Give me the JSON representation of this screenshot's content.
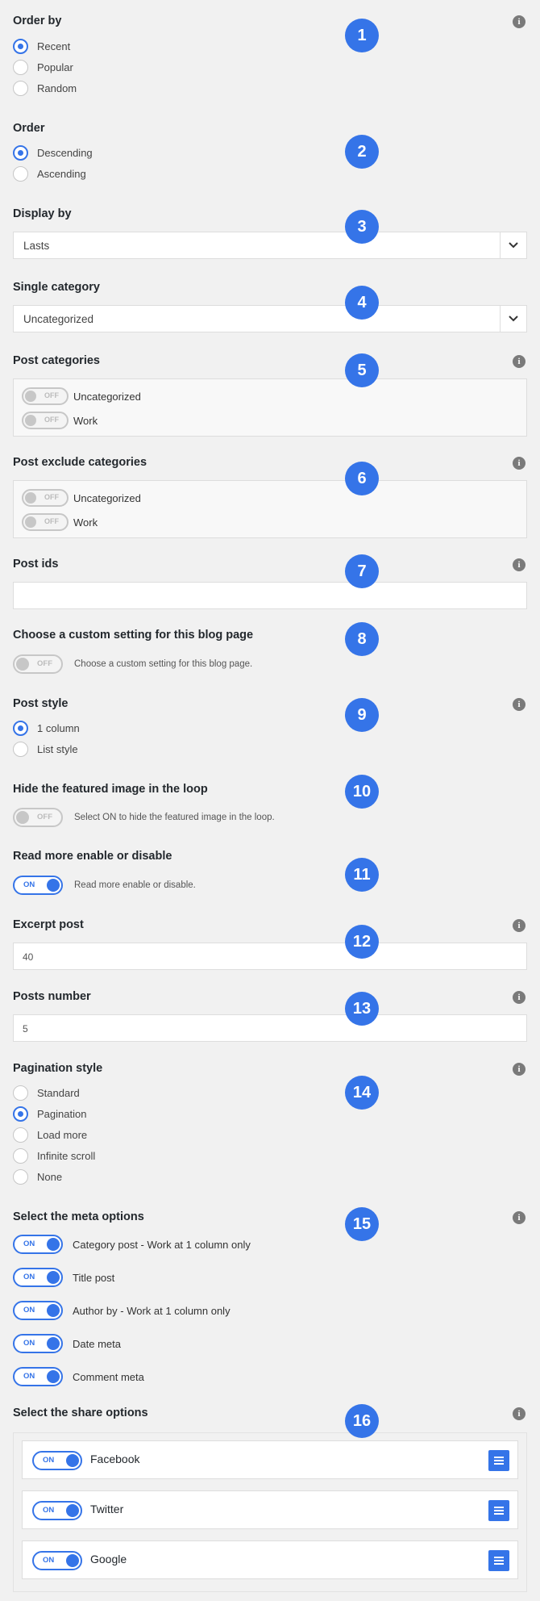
{
  "sections": {
    "order_by": {
      "title": "Order by",
      "options": [
        "Recent",
        "Popular",
        "Random"
      ],
      "selected": "Recent"
    },
    "order": {
      "title": "Order",
      "options": [
        "Descending",
        "Ascending"
      ],
      "selected": "Descending"
    },
    "display_by": {
      "title": "Display by",
      "value": "Lasts"
    },
    "single_category": {
      "title": "Single category",
      "value": "Uncategorized"
    },
    "post_categories": {
      "title": "Post categories",
      "items": [
        {
          "label": "Uncategorized",
          "state": "OFF"
        },
        {
          "label": "Work",
          "state": "OFF"
        }
      ]
    },
    "post_exclude_categories": {
      "title": "Post exclude categories",
      "items": [
        {
          "label": "Uncategorized",
          "state": "OFF"
        },
        {
          "label": "Work",
          "state": "OFF"
        }
      ]
    },
    "post_ids": {
      "title": "Post ids",
      "value": ""
    },
    "custom_setting": {
      "title": "Choose a custom setting for this blog page",
      "state": "OFF",
      "description": "Choose a custom setting for this blog page."
    },
    "post_style": {
      "title": "Post style",
      "options": [
        "1 column",
        "List style"
      ],
      "selected": "1 column"
    },
    "hide_featured": {
      "title": "Hide the featured image in the loop",
      "state": "OFF",
      "description": "Select ON to hide the featured image in the loop."
    },
    "read_more": {
      "title": "Read more enable or disable",
      "state": "ON",
      "description": "Read more enable or disable."
    },
    "excerpt_post": {
      "title": "Excerpt post",
      "value": "40"
    },
    "posts_number": {
      "title": "Posts number",
      "value": "5"
    },
    "pagination_style": {
      "title": "Pagination style",
      "options": [
        "Standard",
        "Pagination",
        "Load more",
        "Infinite scroll",
        "None"
      ],
      "selected": "Pagination"
    },
    "meta_options": {
      "title": "Select the meta options",
      "items": [
        {
          "label": "Category post - Work at 1 column only",
          "state": "ON"
        },
        {
          "label": "Title post",
          "state": "ON"
        },
        {
          "label": "Author by - Work at 1 column only",
          "state": "ON"
        },
        {
          "label": "Date meta",
          "state": "ON"
        },
        {
          "label": "Comment meta",
          "state": "ON"
        }
      ]
    },
    "share_options": {
      "title": "Select the share options",
      "items": [
        {
          "label": "Facebook",
          "state": "ON"
        },
        {
          "label": "Twitter",
          "state": "ON"
        },
        {
          "label": "Google",
          "state": "ON"
        }
      ]
    }
  },
  "badges": [
    "1",
    "2",
    "3",
    "4",
    "5",
    "6",
    "7",
    "8",
    "9",
    "10",
    "11",
    "12",
    "13",
    "14",
    "15",
    "16"
  ],
  "info_glyph": "i",
  "icons": {
    "info": "info-icon",
    "dropdown": "chevron-down-icon",
    "drag": "drag-handle-icon"
  },
  "colors": {
    "accent": "#3574e8",
    "badge": "#3574e8",
    "info": "#7a7a7a",
    "toggle_off": "#c7c7c7"
  }
}
